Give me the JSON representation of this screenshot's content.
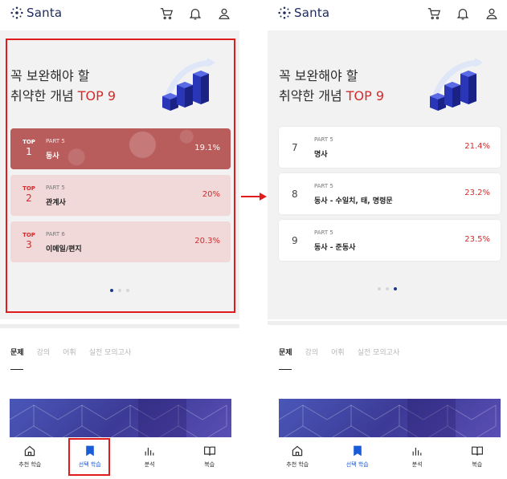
{
  "app": {
    "logo_text": "Santa"
  },
  "header_icons": [
    "cart-icon",
    "bell-icon",
    "user-icon"
  ],
  "hero": {
    "title_line1": "꼭 보완해야 할",
    "title_line2_prefix": "취약한 개념 ",
    "title_line2_highlight": "TOP 9"
  },
  "ranking": {
    "top_label": "TOP",
    "left_page": [
      {
        "rank": "1",
        "part": "PART 5",
        "concept": "동사",
        "percent": "19.1%"
      },
      {
        "rank": "2",
        "part": "PART 5",
        "concept": "관계사",
        "percent": "20%"
      },
      {
        "rank": "3",
        "part": "PART 6",
        "concept": "이메일/편지",
        "percent": "20.3%"
      }
    ],
    "right_page": [
      {
        "rank": "7",
        "part": "PART 5",
        "concept": "명사",
        "percent": "21.4%"
      },
      {
        "rank": "8",
        "part": "PART 5",
        "concept": "동사 - 수일치, 태, 명령문",
        "percent": "23.2%"
      },
      {
        "rank": "9",
        "part": "PART 5",
        "concept": "동사 - 준동사",
        "percent": "23.5%"
      }
    ]
  },
  "pager": {
    "pages": 3,
    "left_active": 1,
    "right_active": 3
  },
  "tabs": [
    "문제",
    "강의",
    "어휘",
    "실전 모의고사"
  ],
  "bottom_nav": [
    {
      "label": "추천 학습",
      "icon": "home-icon"
    },
    {
      "label": "선택 학습",
      "icon": "bookmark-icon"
    },
    {
      "label": "분석",
      "icon": "bar-chart-icon"
    },
    {
      "label": "복습",
      "icon": "book-icon"
    }
  ],
  "colors": {
    "accent_red": "#d32b2b",
    "brand_navy": "#1c2a5a",
    "active_blue": "#1a5bd8",
    "highlight_box": "#e01b1b"
  }
}
